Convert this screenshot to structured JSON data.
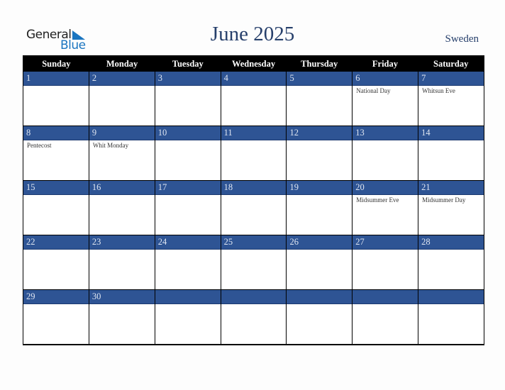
{
  "logo": {
    "general": "General",
    "blue": "Blue"
  },
  "title": "June 2025",
  "country": "Sweden",
  "weekdays": [
    "Sunday",
    "Monday",
    "Tuesday",
    "Wednesday",
    "Thursday",
    "Friday",
    "Saturday"
  ],
  "weeks": [
    [
      {
        "day": "1",
        "event": ""
      },
      {
        "day": "2",
        "event": ""
      },
      {
        "day": "3",
        "event": ""
      },
      {
        "day": "4",
        "event": ""
      },
      {
        "day": "5",
        "event": ""
      },
      {
        "day": "6",
        "event": "National Day"
      },
      {
        "day": "7",
        "event": "Whitsun Eve"
      }
    ],
    [
      {
        "day": "8",
        "event": "Pentecost"
      },
      {
        "day": "9",
        "event": "Whit Monday"
      },
      {
        "day": "10",
        "event": ""
      },
      {
        "day": "11",
        "event": ""
      },
      {
        "day": "12",
        "event": ""
      },
      {
        "day": "13",
        "event": ""
      },
      {
        "day": "14",
        "event": ""
      }
    ],
    [
      {
        "day": "15",
        "event": ""
      },
      {
        "day": "16",
        "event": ""
      },
      {
        "day": "17",
        "event": ""
      },
      {
        "day": "18",
        "event": ""
      },
      {
        "day": "19",
        "event": ""
      },
      {
        "day": "20",
        "event": "Midsummer Eve"
      },
      {
        "day": "21",
        "event": "Midsummer Day"
      }
    ],
    [
      {
        "day": "22",
        "event": ""
      },
      {
        "day": "23",
        "event": ""
      },
      {
        "day": "24",
        "event": ""
      },
      {
        "day": "25",
        "event": ""
      },
      {
        "day": "26",
        "event": ""
      },
      {
        "day": "27",
        "event": ""
      },
      {
        "day": "28",
        "event": ""
      }
    ],
    [
      {
        "day": "29",
        "event": ""
      },
      {
        "day": "30",
        "event": ""
      },
      {
        "day": "",
        "event": ""
      },
      {
        "day": "",
        "event": ""
      },
      {
        "day": "",
        "event": ""
      },
      {
        "day": "",
        "event": ""
      },
      {
        "day": "",
        "event": ""
      }
    ]
  ]
}
